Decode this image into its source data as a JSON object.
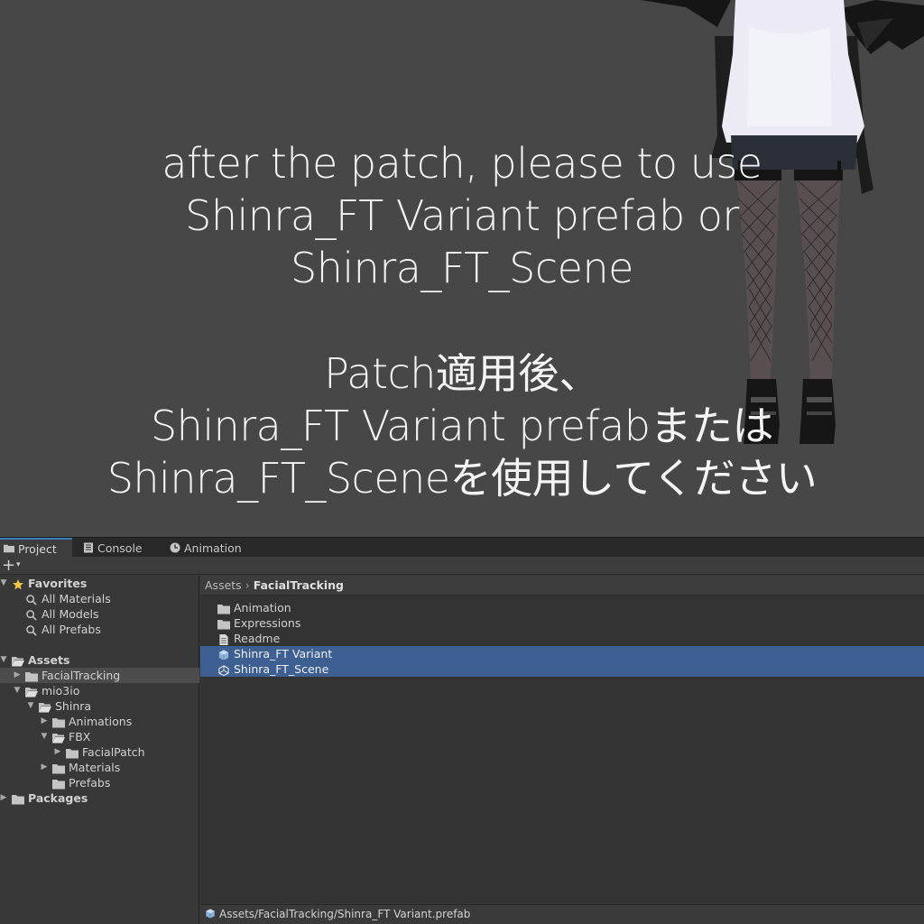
{
  "banner": {
    "english_lines": [
      "after the patch, please to use",
      "Shinra_FT Variant prefab or",
      "Shinra_FT_Scene"
    ],
    "japanese_lines": [
      "Patch適用後、",
      "Shinra_FT Variant prefabまたは",
      "Shinra_FT_Sceneを使用してください"
    ]
  },
  "tabs": [
    {
      "label": "Project",
      "icon": "folder-icon",
      "active": true
    },
    {
      "label": "Console",
      "icon": "console-icon",
      "active": false
    },
    {
      "label": "Animation",
      "icon": "animation-clock-icon",
      "active": false
    }
  ],
  "toolbar": {
    "add_label": "+",
    "add_caret": "▾"
  },
  "tree": [
    {
      "label": "Favorites",
      "depth": 0,
      "arrow": "▼",
      "icon": "star-icon",
      "bold": true
    },
    {
      "label": "All Materials",
      "depth": 1,
      "arrow": "",
      "icon": "search-icon"
    },
    {
      "label": "All Models",
      "depth": 1,
      "arrow": "",
      "icon": "search-icon"
    },
    {
      "label": "All Prefabs",
      "depth": 1,
      "arrow": "",
      "icon": "search-icon"
    },
    {
      "label": "",
      "spacer": true
    },
    {
      "label": "Assets",
      "depth": 0,
      "arrow": "▼",
      "icon": "folder-open-icon",
      "bold": true
    },
    {
      "label": "FacialTracking",
      "depth": 1,
      "arrow": "▶",
      "icon": "folder-icon",
      "selected": true
    },
    {
      "label": "mio3io",
      "depth": 1,
      "arrow": "▼",
      "icon": "folder-open-icon"
    },
    {
      "label": "Shinra",
      "depth": 2,
      "arrow": "▼",
      "icon": "folder-open-icon"
    },
    {
      "label": "Animations",
      "depth": 3,
      "arrow": "▶",
      "icon": "folder-icon"
    },
    {
      "label": "FBX",
      "depth": 3,
      "arrow": "▼",
      "icon": "folder-open-icon"
    },
    {
      "label": "FacialPatch",
      "depth": 4,
      "arrow": "▶",
      "icon": "folder-icon"
    },
    {
      "label": "Materials",
      "depth": 3,
      "arrow": "▶",
      "icon": "folder-icon"
    },
    {
      "label": "Prefabs",
      "depth": 3,
      "arrow": "",
      "icon": "folder-icon"
    },
    {
      "label": "Packages",
      "depth": 0,
      "arrow": "▶",
      "icon": "folder-icon",
      "bold": true
    }
  ],
  "breadcrumb": {
    "root": "Assets",
    "separator": "›",
    "current": "FacialTracking"
  },
  "files": [
    {
      "label": "Animation",
      "icon": "folder-icon",
      "selected": false
    },
    {
      "label": "Expressions",
      "icon": "folder-icon",
      "selected": false
    },
    {
      "label": "Readme",
      "icon": "document-icon",
      "selected": false
    },
    {
      "label": "Shinra_FT Variant",
      "icon": "prefab-variant-icon",
      "selected": true
    },
    {
      "label": "Shinra_FT_Scene",
      "icon": "unity-scene-icon",
      "selected": true
    }
  ],
  "status": {
    "path": "Assets/FacialTracking/Shinra_FT Variant.prefab",
    "icon": "prefab-variant-icon"
  },
  "colors": {
    "selection": "#3d5f92",
    "accent": "#3a79bb",
    "tree_selection": "#4c4c4c"
  }
}
